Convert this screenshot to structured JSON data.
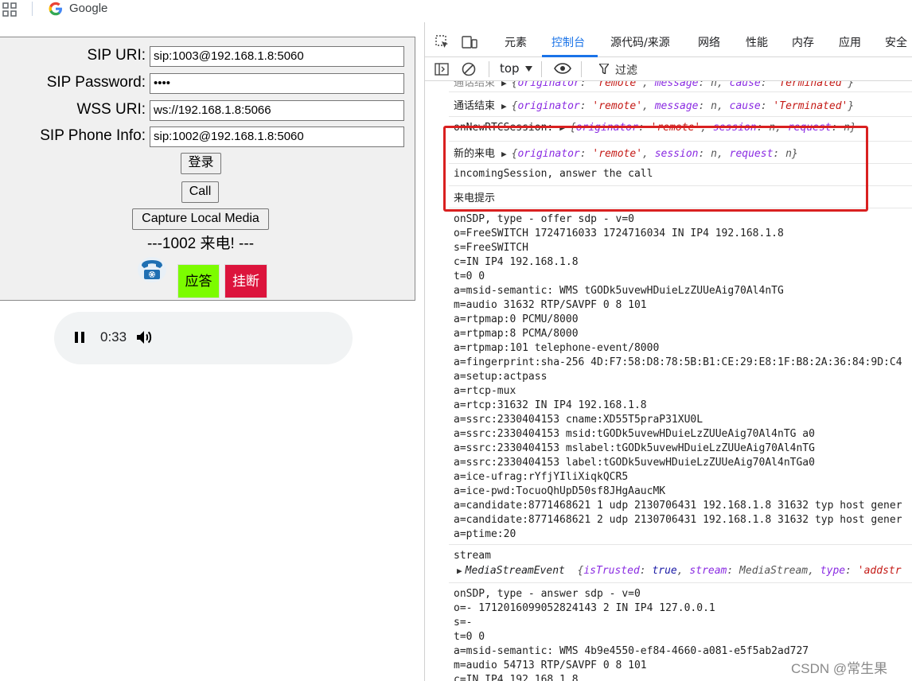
{
  "browser": {
    "bookmark_label": "Google"
  },
  "form": {
    "rows": [
      {
        "label": "SIP URI:",
        "value": "sip:1003@192.168.1.8:5060"
      },
      {
        "label": "SIP Password:",
        "value": "••••"
      },
      {
        "label": "WSS URI:",
        "value": "ws://192.168.1.8:5066"
      },
      {
        "label": "SIP Phone Info:",
        "value": "sip:1002@192.168.1.8:5060"
      }
    ],
    "login_button": "登录",
    "call_button": "Call",
    "capture_button": "Capture Local Media",
    "status_text": "---1002 来电! ---",
    "answer_button": "应答",
    "hangup_button": "挂断"
  },
  "audio": {
    "time": "0:33"
  },
  "devtools": {
    "tabs": [
      "元素",
      "控制台",
      "源代码/来源",
      "网络",
      "性能",
      "内存",
      "应用",
      "安全"
    ],
    "active_tab": "控制台",
    "context": "top",
    "filter_placeholder": "过滤",
    "logs": {
      "l0_label": "通话结束",
      "l1_label": "通话结束",
      "l2_label": "onNewRTCSession:",
      "l3_label": "新的来电",
      "l4_text": "incomingSession, answer the call",
      "l5_text": "来电提示",
      "sdp_offer": [
        "onSDP, type -  offer  sdp -  v=0",
        "o=FreeSWITCH 1724716033 1724716034 IN IP4 192.168.1.8",
        "s=FreeSWITCH",
        "c=IN IP4 192.168.1.8",
        "t=0 0",
        "a=msid-semantic: WMS tGODk5uvewHDuieLzZUUeAig70Al4nTG",
        "m=audio 31632 RTP/SAVPF 0 8 101",
        "a=rtpmap:0 PCMU/8000",
        "a=rtpmap:8 PCMA/8000",
        "a=rtpmap:101 telephone-event/8000",
        "a=fingerprint:sha-256 4D:F7:58:D8:78:5B:B1:CE:29:E8:1F:B8:2A:36:84:9D:C4",
        "a=setup:actpass",
        "a=rtcp-mux",
        "a=rtcp:31632 IN IP4 192.168.1.8",
        "a=ssrc:2330404153 cname:XD55T5praP31XU0L",
        "a=ssrc:2330404153 msid:tGODk5uvewHDuieLzZUUeAig70Al4nTG a0",
        "a=ssrc:2330404153 mslabel:tGODk5uvewHDuieLzZUUeAig70Al4nTG",
        "a=ssrc:2330404153 label:tGODk5uvewHDuieLzZUUeAig70Al4nTGa0",
        "a=ice-ufrag:rYfjYIliXiqkQCR5",
        "a=ice-pwd:TocuoQhUpD50sf8JHgAaucMK",
        "a=candidate:8771468621 1 udp 2130706431 192.168.1.8 31632 typ host gener",
        "a=candidate:8771468621 2 udp 2130706431 192.168.1.8 31632 typ host gener",
        "a=ptime:20"
      ],
      "stream_label": "stream",
      "stream_event": "MediaStreamEvent",
      "sdp_answer": [
        "onSDP, type -  answer  sdp -  v=0",
        "o=- 1712016099052824143 2 IN IP4 127.0.0.1",
        "s=-",
        "t=0 0",
        "a=msid-semantic: WMS 4b9e4550-ef84-4660-a081-e5f5ab2ad727",
        "m=audio 54713 RTP/SAVPF 0 8 101",
        "c=IN IP4 192.168.1.8"
      ]
    }
  },
  "watermark": "CSDN @常生果"
}
